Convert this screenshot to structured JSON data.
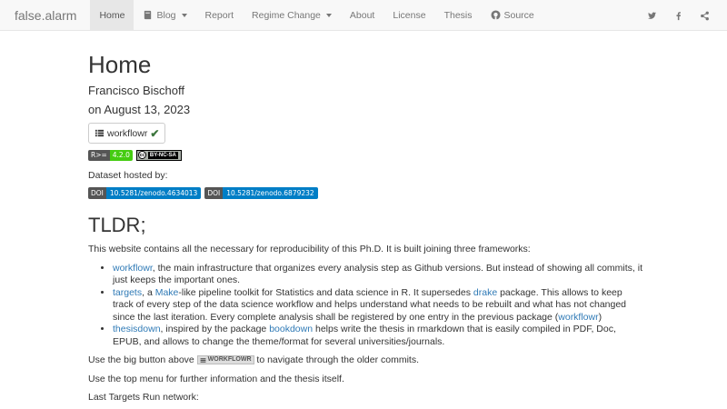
{
  "navbar": {
    "brand": "false.alarm",
    "items": [
      {
        "label": "Home",
        "active": true
      },
      {
        "label": "Blog",
        "icon": "book-icon",
        "dropdown": true
      },
      {
        "label": "Report"
      },
      {
        "label": "Regime Change",
        "dropdown": true
      },
      {
        "label": "About"
      },
      {
        "label": "License"
      },
      {
        "label": "Thesis"
      },
      {
        "label": "Source",
        "icon": "github-icon"
      }
    ],
    "right_icons": [
      "twitter-icon",
      "facebook-icon",
      "share-icon"
    ]
  },
  "page": {
    "title": "Home",
    "author": "Francisco Bischoff",
    "date": "on August 13, 2023",
    "workflowr_button": "workflowr",
    "badges": {
      "r_label": "R>=",
      "r_version": "4.2.0",
      "license_text": "BY-NC-SA",
      "cc_mark": "cc"
    },
    "dataset_label": "Dataset hosted by:",
    "doi_badges": [
      {
        "label": "DOI",
        "value": "10.5281/zenodo.4634013"
      },
      {
        "label": "DOI",
        "value": "10.5281/zenodo.6879232"
      }
    ],
    "tldr_heading": "TLDR;",
    "intro": "This website contains all the necessary for reproducibility of this Ph.D. It is built joining three frameworks:",
    "bullets": {
      "b1_link": "workflowr",
      "b1_text": ", the main infrastructure that organizes every analysis step as Github versions. But instead of showing all commits, it just keeps the important ones.",
      "b2_link": "targets",
      "b2_text1": ", a ",
      "b2_link2": "Make",
      "b2_text2": "-like pipeline toolkit for Statistics and data science in R. It supersedes ",
      "b2_link3": "drake",
      "b2_text3": " package. This allows to keep track of every step of the data science workflow and helps understand what needs to be rebuilt and what has not changed since the last iteration. Every complete analysis shall be registered by one entry in the previous package (",
      "b2_link4": "workflowr",
      "b2_text4": ")",
      "b3_link": "thesisdown",
      "b3_text1": ", inspired by the package ",
      "b3_link2": "bookdown",
      "b3_text2": " helps write the thesis in rmarkdown that is easily compiled in PDF, Doc, EPUB, and allows to change the theme/format for several universities/journals."
    },
    "use_button_pre": "Use the big button above ",
    "inline_badge": "WORKFLOWR",
    "use_button_post": " to navigate through the older commits.",
    "top_menu": "Use the top menu for further information and the thesis itself.",
    "last_run": "Last Targets Run network:"
  }
}
